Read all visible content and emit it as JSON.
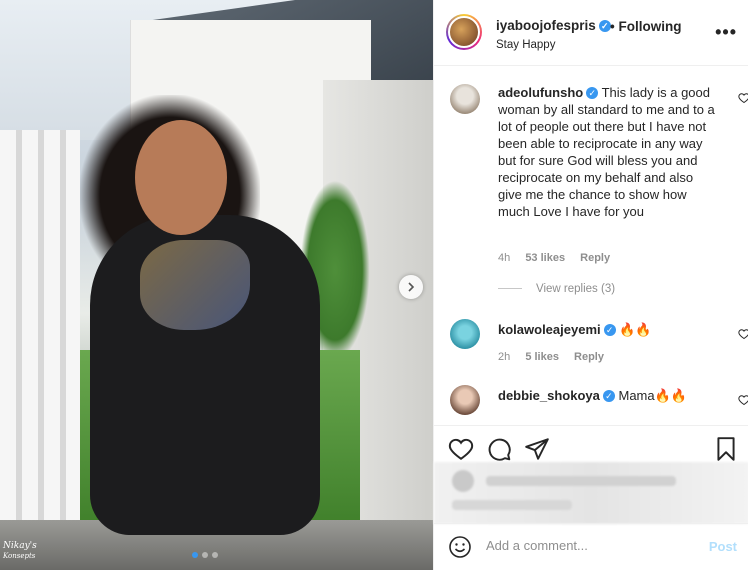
{
  "post": {
    "watermark_line1": "Nikay's",
    "watermark_line2": "Konsepts",
    "carousel_next_icon": "chevron-right-icon"
  },
  "header": {
    "username": "iyaboojofespris",
    "follow_label": "• Following",
    "subtitle": "Stay Happy",
    "more_icon": "more-horizontal-icon"
  },
  "comments": [
    {
      "username": "adeolufunsho",
      "verified": true,
      "text": "This lady is a good woman by all standard to me and to a lot of people out there but I have not been able to reciprocate in any way but for sure God will bless you and reciprocate on my behalf and also give me the chance to show how much Love I have for you",
      "time": "4h",
      "likes": "53 likes",
      "reply": "Reply",
      "view_replies": "View replies (3)"
    },
    {
      "username": "kolawoleajeyemi",
      "verified": true,
      "text": "🔥🔥",
      "time": "2h",
      "likes": "5 likes",
      "reply": "Reply"
    },
    {
      "username": "debbie_shokoya",
      "verified": true,
      "text": "Mama🔥🔥"
    }
  ],
  "actions": {
    "like_icon": "heart-icon",
    "comment_icon": "comment-icon",
    "share_icon": "send-icon",
    "save_icon": "bookmark-icon"
  },
  "add_comment": {
    "placeholder": "Add a comment...",
    "post_label": "Post",
    "emoji_icon": "emoji-icon"
  },
  "colors": {
    "verified": "#3897f0",
    "post_button_disabled": "#b2dffc",
    "muted_text": "#8e8e8e"
  }
}
